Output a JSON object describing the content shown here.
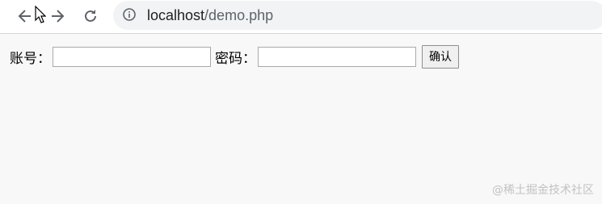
{
  "browser": {
    "url_host": "localhost",
    "url_path": "/demo.php",
    "nav_icons": [
      "back-arrow-icon",
      "forward-arrow-icon",
      "reload-icon",
      "info-icon"
    ]
  },
  "form": {
    "account_label": "账号：",
    "account_value": "",
    "password_label": "密码：",
    "password_value": "",
    "confirm_label": "确认"
  },
  "watermark": "@稀土掘金技术社区"
}
